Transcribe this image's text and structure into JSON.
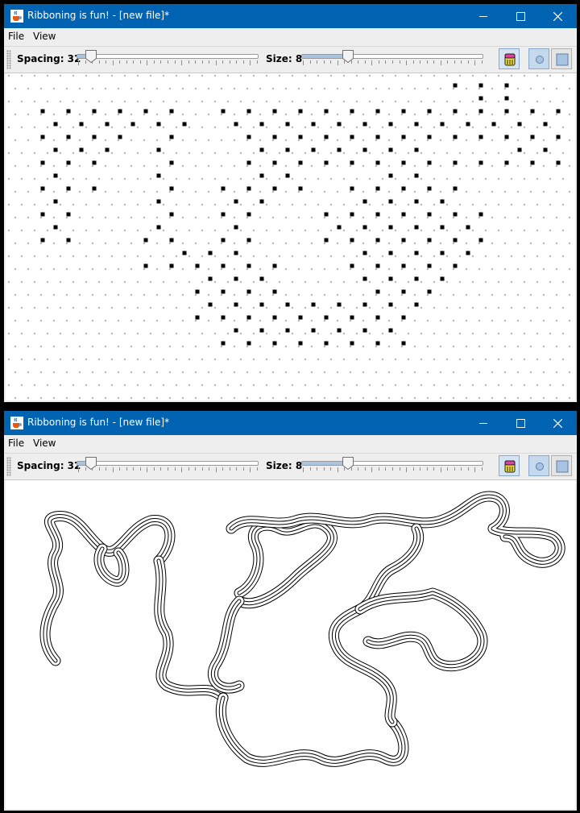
{
  "windows": [
    {
      "title": "Ribboning is fun! - [new file]*",
      "menu": {
        "file": "File",
        "view": "View"
      },
      "toolbar": {
        "spacing_label": "Spacing: 32",
        "spacing_value": 32,
        "size_label": "Size: 8",
        "size_value": 8
      },
      "mode": "dots"
    },
    {
      "title": "Ribboning is fun! - [new file]*",
      "menu": {
        "file": "File",
        "view": "View"
      },
      "toolbar": {
        "spacing_label": "Spacing: 32",
        "spacing_value": 32,
        "size_label": "Size: 8",
        "size_value": 8
      },
      "mode": "ribbon"
    }
  ],
  "icons": {
    "app": "java-cup-icon",
    "minimize": "minimize-icon",
    "maximize": "maximize-icon",
    "close": "close-icon",
    "erase": "eraser-bucket-icon",
    "dot_mode": "circle-dot-icon",
    "square_mode": "square-icon"
  },
  "colors": {
    "titlebar": "#0063b1",
    "window_bg": "#eeeeee",
    "canvas_bg": "#ffffff",
    "grid_dot": "#b4b4b4",
    "active_dot": "#000000",
    "selected_tool": "#c4d8ee"
  }
}
